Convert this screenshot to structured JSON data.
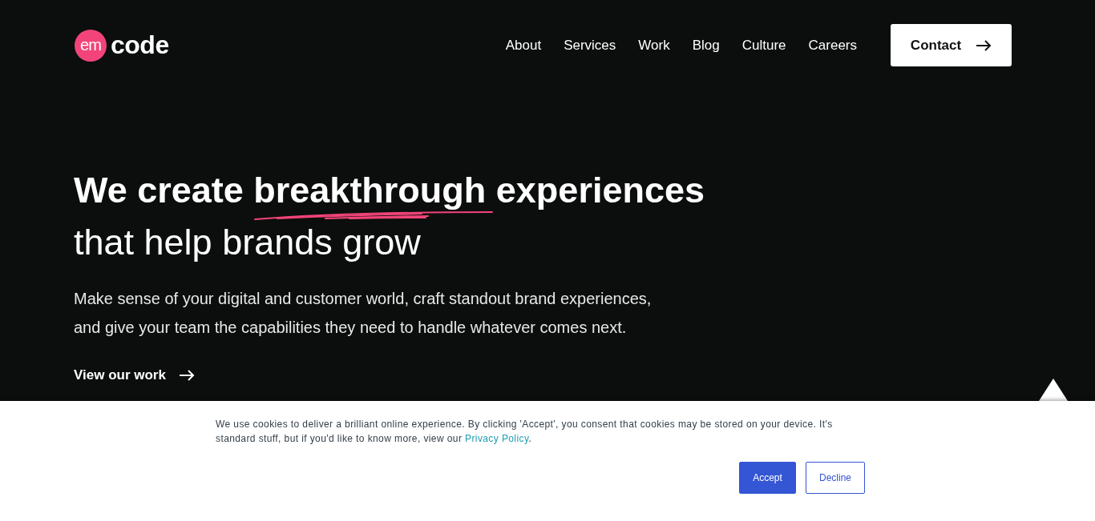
{
  "logo": {
    "badge": "em",
    "word": "code"
  },
  "nav": [
    "About",
    "Services",
    "Work",
    "Blog",
    "Culture",
    "Careers"
  ],
  "contact_button": "Contact",
  "hero": {
    "line_1": "We create breakthrough experiences",
    "line_2": "that help brands grow",
    "description": "Make sense of your digital and customer world, craft standout brand experiences, and give your team the capabilities they need to handle whatever comes next.",
    "link": "View our work"
  },
  "cookie_banner": {
    "message": "We use cookies to deliver a brilliant online experience. By clicking 'Accept', you consent that cookies may be stored on your device. It's standard stuff, but if you'd like to know more, view our",
    "link": "Privacy Policy",
    "end": ".",
    "buttons": [
      {
        "label": "Accept",
        "kind": "primary"
      },
      {
        "label": "Decline",
        "kind": "secondary"
      }
    ]
  }
}
